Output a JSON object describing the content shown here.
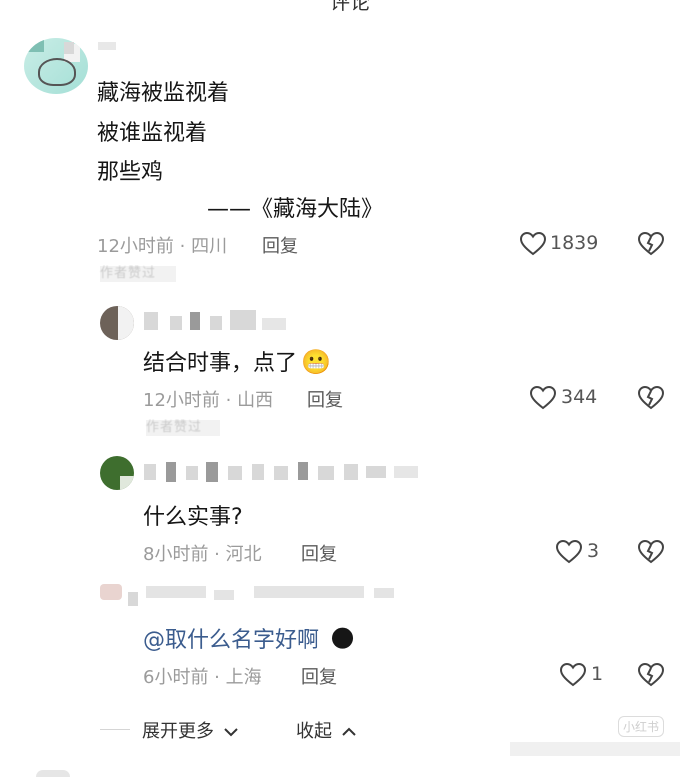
{
  "top_header_partial": "评论",
  "main_comment": {
    "lines": [
      "藏海被监视着",
      "被谁监视着",
      "那些鸡"
    ],
    "attribution": "——《藏海大陆》",
    "time_location": "12小时前 · 四川",
    "reply_label": "回复",
    "like_count": "1839",
    "author_tag": "作者赞过"
  },
  "replies": [
    {
      "text": "结合时事，点了",
      "emoji": "😬",
      "time_location": "12小时前 · 山西",
      "reply_label": "回复",
      "like_count": "344",
      "author_tag": "作者赞过"
    },
    {
      "text": "什么实事?",
      "time_location": "8小时前 · 河北",
      "reply_label": "回复",
      "like_count": "3"
    },
    {
      "mention": "@取什么名字好啊",
      "emoji": "🌑",
      "time_location": "6小时前 · 上海",
      "reply_label": "回复",
      "like_count": "1"
    }
  ],
  "footer": {
    "expand_label": "展开更多",
    "collapse_label": "收起"
  },
  "watermark": "小红书"
}
